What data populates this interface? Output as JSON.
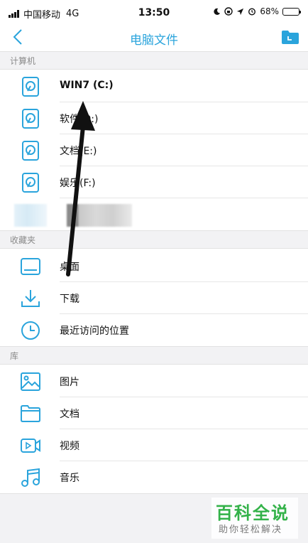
{
  "status_bar": {
    "carrier": "中国移动",
    "network": "4G",
    "time": "13:50",
    "battery": "68%",
    "battery_level": 0.68
  },
  "nav": {
    "title": "电脑文件"
  },
  "sections": {
    "computer": "计算机",
    "favorites": "收藏夹",
    "library": "库"
  },
  "computer_items": [
    {
      "label": "WIN7 (C:)"
    },
    {
      "label": "软件(D:)"
    },
    {
      "label": "文档(E:)"
    },
    {
      "label": "娱乐(F:)"
    }
  ],
  "favorite_items": [
    {
      "label": "桌面"
    },
    {
      "label": "下载"
    },
    {
      "label": "最近访问的位置"
    }
  ],
  "library_items": [
    {
      "label": "图片"
    },
    {
      "label": "文档"
    },
    {
      "label": "视频"
    },
    {
      "label": "音乐"
    }
  ],
  "watermark": {
    "title": "百科全说",
    "subtitle": "助你轻松解决"
  },
  "colors": {
    "accent": "#2aa4dc",
    "section_bg": "#f2f2f4",
    "watermark_green": "#33b249"
  }
}
